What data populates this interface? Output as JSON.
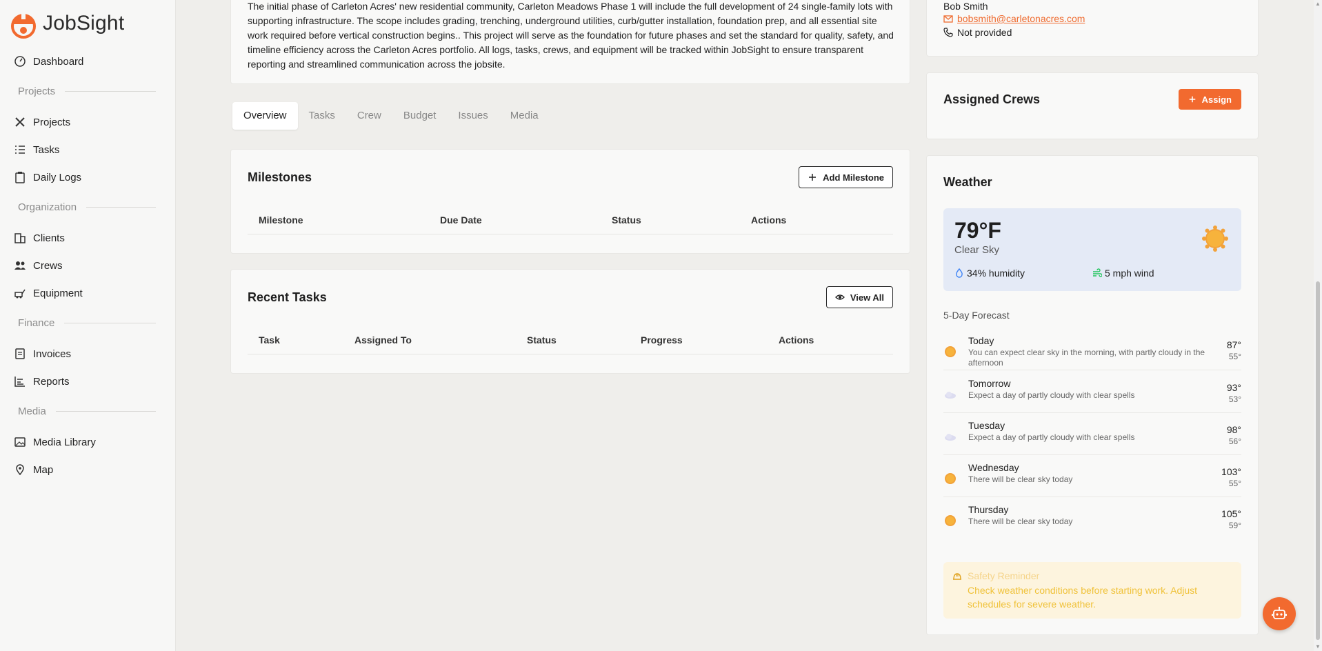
{
  "brand": {
    "name": "JobSight"
  },
  "sidebar": {
    "items": [
      {
        "label": "Dashboard",
        "icon": "dashboard-icon"
      },
      {
        "section": "Projects"
      },
      {
        "label": "Projects",
        "icon": "tools-icon"
      },
      {
        "label": "Tasks",
        "icon": "list-check-icon"
      },
      {
        "label": "Daily Logs",
        "icon": "clipboard-icon"
      },
      {
        "section": "Organization"
      },
      {
        "label": "Clients",
        "icon": "building-icon"
      },
      {
        "label": "Crews",
        "icon": "users-icon"
      },
      {
        "label": "Equipment",
        "icon": "equipment-icon"
      },
      {
        "section": "Finance"
      },
      {
        "label": "Invoices",
        "icon": "invoice-icon"
      },
      {
        "label": "Reports",
        "icon": "chart-icon"
      },
      {
        "section": "Media"
      },
      {
        "label": "Media Library",
        "icon": "image-icon"
      },
      {
        "label": "Map",
        "icon": "map-pin-icon"
      }
    ]
  },
  "project": {
    "description": "The initial phase of Carleton Acres' new residential community, Carleton Meadows Phase 1 will include the full development of 24 single-family lots with supporting infrastructure. The scope includes grading, trenching, underground utilities, curb/gutter installation, foundation prep, and all essential site work required before vertical construction begins.. This project will serve as the foundation for future phases and set the standard for quality, safety, and timeline efficiency across the Carleton Acres portfolio. All logs, tasks, crews, and equipment will be tracked within JobSight to ensure transparent reporting and streamlined communication across the jobsite."
  },
  "tabs": [
    "Overview",
    "Tasks",
    "Crew",
    "Budget",
    "Issues",
    "Media"
  ],
  "milestones": {
    "title": "Milestones",
    "add_label": "Add Milestone",
    "columns": [
      "Milestone",
      "Due Date",
      "Status",
      "Actions"
    ]
  },
  "recent_tasks": {
    "title": "Recent Tasks",
    "view_all_label": "View All",
    "columns": [
      "Task",
      "Assigned To",
      "Status",
      "Progress",
      "Actions"
    ]
  },
  "contact": {
    "name": "Bob Smith",
    "email": "bobsmith@carletonacres.com",
    "phone": "Not provided"
  },
  "crews": {
    "title": "Assigned Crews",
    "assign_label": "Assign"
  },
  "weather": {
    "title": "Weather",
    "temp": "79°F",
    "condition": "Clear Sky",
    "humidity": "34% humidity",
    "wind": "5 mph wind",
    "forecast_title": "5-Day Forecast",
    "forecast": [
      {
        "day": "Today",
        "desc": "You can expect clear sky in the morning, with partly cloudy in the afternoon",
        "hi": "87°",
        "lo": "55°",
        "icon": "sun-icon"
      },
      {
        "day": "Tomorrow",
        "desc": "Expect a day of partly cloudy with clear spells",
        "hi": "93°",
        "lo": "53°",
        "icon": "cloud-icon"
      },
      {
        "day": "Tuesday",
        "desc": "Expect a day of partly cloudy with clear spells",
        "hi": "98°",
        "lo": "56°",
        "icon": "cloud-icon"
      },
      {
        "day": "Wednesday",
        "desc": "There will be clear sky today",
        "hi": "103°",
        "lo": "55°",
        "icon": "sun-icon"
      },
      {
        "day": "Thursday",
        "desc": "There will be clear sky today",
        "hi": "105°",
        "lo": "59°",
        "icon": "sun-icon"
      }
    ],
    "safety_title": "Safety Reminder",
    "safety_text": "Check weather conditions before starting work. Adjust schedules for severe weather."
  },
  "colors": {
    "accent": "#f26a2f",
    "weather_bg": "#e4eaf6",
    "safety_bg": "#fdf4de"
  }
}
